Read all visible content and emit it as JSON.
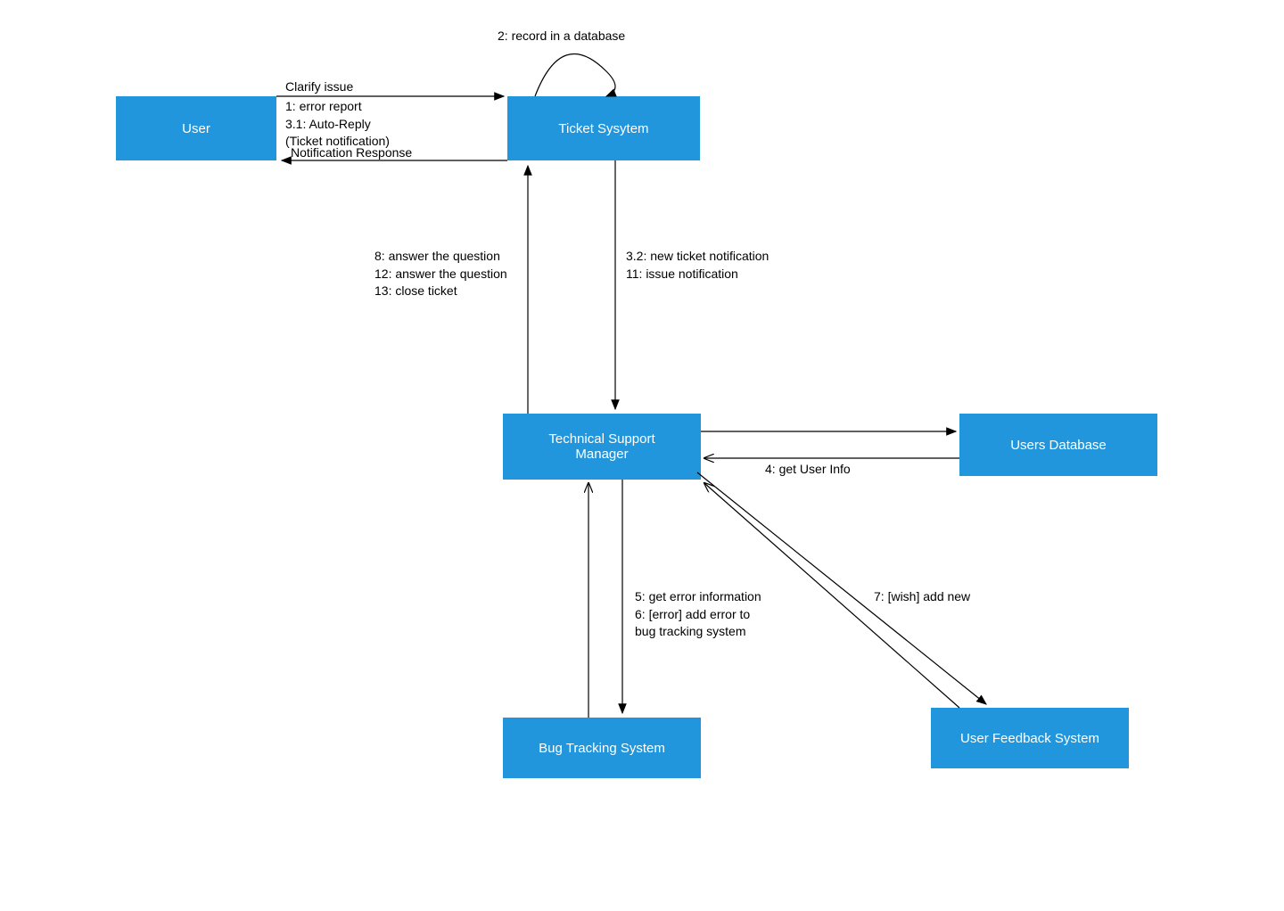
{
  "nodes": {
    "user": "User",
    "ticket_system": "Ticket Sysytem",
    "tech_support": "Technical Support\nManager",
    "users_db": "Users Database",
    "bug_tracking": "Bug Tracking System",
    "user_feedback": "User Feedback System"
  },
  "edges": {
    "clarify_issue": "Clarify issue",
    "error_report": "1: error report",
    "auto_reply": "3.1: Auto-Reply",
    "ticket_notification": "(Ticket notification)",
    "notification_response": "Notification Response",
    "record_db": "2: record in a database",
    "new_ticket": "3.2: new ticket notification",
    "issue_notification": "11: issue notification",
    "answer_8": "8: answer the question",
    "answer_12": "12: answer the question",
    "close_ticket": "13: close ticket",
    "get_user_info": "4: get User Info",
    "get_error_info": "5: get error information",
    "add_error": "6: [error] add error to",
    "bug_tracking_sys": "bug tracking system",
    "wish_add": "7: [wish] add new"
  },
  "colors": {
    "node_bg": "#2196dc",
    "arrow": "#000000"
  }
}
